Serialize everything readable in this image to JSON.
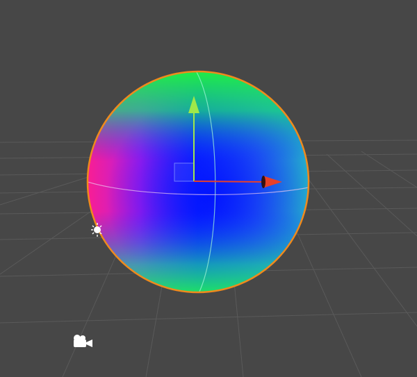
{
  "scene": {
    "background_color": "#474747",
    "grid_color": "#5a5a5a",
    "selection_outline_color": "#f08a1c",
    "axis_colors": {
      "x": "#e8402a",
      "y": "#9fe84a"
    },
    "icons": {
      "light": "light-icon",
      "camera": "camera-icon"
    },
    "selected_object": "sphere"
  }
}
